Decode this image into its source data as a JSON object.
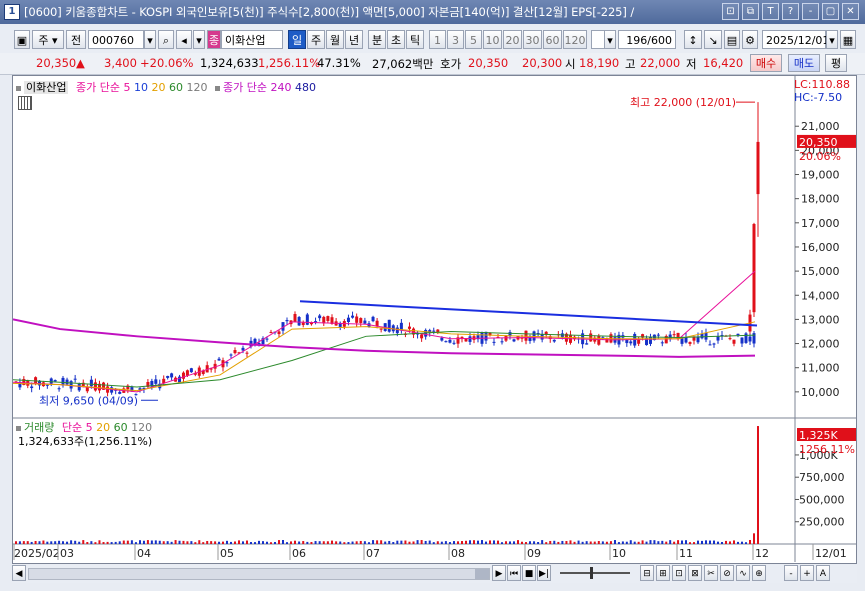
{
  "window": {
    "app_number": "1",
    "title": "[0600] 키움종합차트 - KOSPI 외국인보유[5(천)] 주식수[2,800(천)] 액면[5,000] 자본금[140(억)] 결산[12월] EPS[-225] /",
    "buttons": [
      "⊡",
      "⧉",
      "T",
      "?",
      "-",
      "▢",
      "✕"
    ]
  },
  "toolbar": {
    "interval_kind": "주",
    "prev_label": "전",
    "code": "000760",
    "search_icon": "magnifier-icon",
    "sound_icon": "speaker-icon",
    "badge": "종",
    "stock_name": "이화산업",
    "periods": [
      "일",
      "주",
      "월",
      "년",
      "분",
      "초",
      "틱"
    ],
    "active_period": "일",
    "numbers": [
      "1",
      "3",
      "5",
      "10",
      "20",
      "30",
      "60",
      "120"
    ],
    "count": "196/600",
    "date": "2025/12/01"
  },
  "info": {
    "price": "20,350",
    "arrow": "▲",
    "change": "3,400",
    "rate": "+20.06%",
    "volume": "1,324,633",
    "vol_rate": "1,256.11%",
    "other_rate": "47.31%",
    "amount": "27,062백만",
    "hoga_label": "호가",
    "bid": "20,350",
    "ask": "20,300",
    "open_label": "시",
    "open": "18,190",
    "high_label": "고",
    "high": "22,000",
    "low_label": "저",
    "low": "16,420",
    "buy_label": "매수",
    "sell_label": "매도",
    "eval_label": "평"
  },
  "price_legend": {
    "name": "이화산업",
    "ma_label": "종가 단순",
    "ma_periods": [
      "5",
      "10",
      "20",
      "60",
      "120"
    ],
    "ma_colors": [
      "#e8109a",
      "#1a3fd6",
      "#e3a000",
      "#2c8a2c",
      "#7a7a7a"
    ],
    "ma2_label": "종가 단순",
    "ma2_periods": [
      "240",
      "480"
    ],
    "ma2_colors": [
      "#c010c0",
      "#1a1aa0"
    ]
  },
  "volume_legend": {
    "label": "거래량",
    "ma_label": "단순",
    "ma_periods": [
      "5",
      "20",
      "60",
      "120"
    ],
    "ma_colors": [
      "#e8109a",
      "#e3a000",
      "#2c8a2c",
      "#7a7a7a"
    ],
    "value": "1,324,633주(1,256.11%)"
  },
  "annotations": {
    "high": "최고 22,000 (12/01)",
    "low": "최저 9,650 (04/09)",
    "lc": "LC:110.88",
    "hc": "HC:-7.50",
    "last_price_tag": "20,350",
    "last_rate_tag": "20.06%",
    "vol_tag": "1,325K",
    "vol_rate_tag": "1256.11%"
  },
  "colors": {
    "up": "#e0101a",
    "down": "#1530c8",
    "ma5": "#e8109a",
    "ma10": "#1a3fd6",
    "ma20": "#e3a000",
    "ma60": "#2c8a2c",
    "ma120": "#7a7a7a",
    "ma240": "#c010c0",
    "trendline": "#1a2ee0"
  },
  "bottom": {
    "buttons": [
      "▶",
      "⏮",
      "■",
      "▶|"
    ],
    "tools": [
      "⊟",
      "⊞",
      "⊡",
      "⊠",
      "✂",
      "⊘",
      "∿",
      "⊕",
      "-",
      "+",
      "A"
    ]
  },
  "chart_data": {
    "type": "candlestick",
    "title": "이화산업",
    "y_axis_ticks": [
      10000,
      11000,
      12000,
      13000,
      14000,
      15000,
      16000,
      17000,
      18000,
      19000,
      20000,
      21000
    ],
    "ylim": [
      9000,
      22500
    ],
    "volume_ticks": [
      "250,000",
      "500,000",
      "750,000",
      "1,000K"
    ],
    "volume_ylim": [
      0,
      1325000
    ],
    "x_labels": [
      "2025/02",
      "03",
      "04",
      "05",
      "06",
      "07",
      "08",
      "09",
      "10",
      "11",
      "12",
      "12/01"
    ],
    "price_path": {
      "months": [
        "02",
        "03",
        "04",
        "05",
        "06",
        "07",
        "08",
        "09",
        "10",
        "11",
        "12/01"
      ],
      "approx_close": [
        10400,
        10350,
        10100,
        11200,
        13000,
        12900,
        12200,
        12300,
        12150,
        12200,
        20350
      ]
    },
    "last_candle": {
      "date": "2025/12/01",
      "open": 18190,
      "high": 22000,
      "low": 16420,
      "close": 20350,
      "volume": 1324633
    },
    "extremes": {
      "high": {
        "value": 22000,
        "date": "12/01"
      },
      "low": {
        "value": 9650,
        "date": "04/09"
      }
    },
    "series": [
      {
        "name": "5",
        "values": [
          10400,
          10300,
          10000,
          11100,
          12900,
          12800,
          12200,
          12250,
          12150,
          12200,
          15000
        ]
      },
      {
        "name": "20",
        "values": [
          10350,
          10300,
          10050,
          10700,
          12600,
          12700,
          12400,
          12300,
          12200,
          12200,
          12900
        ]
      },
      {
        "name": "60",
        "values": [
          10500,
          10400,
          10200,
          10500,
          11300,
          12300,
          12500,
          12400,
          12300,
          12250,
          12350
        ]
      },
      {
        "name": "240",
        "values": [
          13000,
          12600,
          12300,
          12050,
          11850,
          11700,
          11600,
          11550,
          11500,
          11450,
          11500
        ]
      }
    ]
  }
}
